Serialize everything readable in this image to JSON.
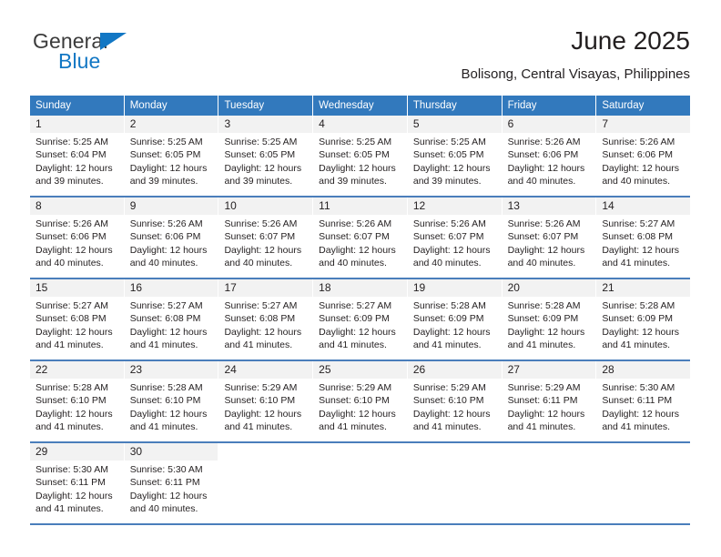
{
  "branding": {
    "logo_primary": "General",
    "logo_secondary": "Blue",
    "logo_accent_color": "#1277c4"
  },
  "header": {
    "title": "June 2025",
    "subtitle": "Bolisong, Central Visayas, Philippines"
  },
  "theme": {
    "header_bg": "#3279bd",
    "row_divider": "#4a7ebb",
    "day_number_bg": "#f2f2f2",
    "text_color": "#231f20"
  },
  "calendar": {
    "weekdays": [
      "Sunday",
      "Monday",
      "Tuesday",
      "Wednesday",
      "Thursday",
      "Friday",
      "Saturday"
    ],
    "weeks": [
      [
        {
          "day": "1",
          "sunrise": "Sunrise: 5:25 AM",
          "sunset": "Sunset: 6:04 PM",
          "daylight": "Daylight: 12 hours and 39 minutes."
        },
        {
          "day": "2",
          "sunrise": "Sunrise: 5:25 AM",
          "sunset": "Sunset: 6:05 PM",
          "daylight": "Daylight: 12 hours and 39 minutes."
        },
        {
          "day": "3",
          "sunrise": "Sunrise: 5:25 AM",
          "sunset": "Sunset: 6:05 PM",
          "daylight": "Daylight: 12 hours and 39 minutes."
        },
        {
          "day": "4",
          "sunrise": "Sunrise: 5:25 AM",
          "sunset": "Sunset: 6:05 PM",
          "daylight": "Daylight: 12 hours and 39 minutes."
        },
        {
          "day": "5",
          "sunrise": "Sunrise: 5:25 AM",
          "sunset": "Sunset: 6:05 PM",
          "daylight": "Daylight: 12 hours and 39 minutes."
        },
        {
          "day": "6",
          "sunrise": "Sunrise: 5:26 AM",
          "sunset": "Sunset: 6:06 PM",
          "daylight": "Daylight: 12 hours and 40 minutes."
        },
        {
          "day": "7",
          "sunrise": "Sunrise: 5:26 AM",
          "sunset": "Sunset: 6:06 PM",
          "daylight": "Daylight: 12 hours and 40 minutes."
        }
      ],
      [
        {
          "day": "8",
          "sunrise": "Sunrise: 5:26 AM",
          "sunset": "Sunset: 6:06 PM",
          "daylight": "Daylight: 12 hours and 40 minutes."
        },
        {
          "day": "9",
          "sunrise": "Sunrise: 5:26 AM",
          "sunset": "Sunset: 6:06 PM",
          "daylight": "Daylight: 12 hours and 40 minutes."
        },
        {
          "day": "10",
          "sunrise": "Sunrise: 5:26 AM",
          "sunset": "Sunset: 6:07 PM",
          "daylight": "Daylight: 12 hours and 40 minutes."
        },
        {
          "day": "11",
          "sunrise": "Sunrise: 5:26 AM",
          "sunset": "Sunset: 6:07 PM",
          "daylight": "Daylight: 12 hours and 40 minutes."
        },
        {
          "day": "12",
          "sunrise": "Sunrise: 5:26 AM",
          "sunset": "Sunset: 6:07 PM",
          "daylight": "Daylight: 12 hours and 40 minutes."
        },
        {
          "day": "13",
          "sunrise": "Sunrise: 5:26 AM",
          "sunset": "Sunset: 6:07 PM",
          "daylight": "Daylight: 12 hours and 40 minutes."
        },
        {
          "day": "14",
          "sunrise": "Sunrise: 5:27 AM",
          "sunset": "Sunset: 6:08 PM",
          "daylight": "Daylight: 12 hours and 41 minutes."
        }
      ],
      [
        {
          "day": "15",
          "sunrise": "Sunrise: 5:27 AM",
          "sunset": "Sunset: 6:08 PM",
          "daylight": "Daylight: 12 hours and 41 minutes."
        },
        {
          "day": "16",
          "sunrise": "Sunrise: 5:27 AM",
          "sunset": "Sunset: 6:08 PM",
          "daylight": "Daylight: 12 hours and 41 minutes."
        },
        {
          "day": "17",
          "sunrise": "Sunrise: 5:27 AM",
          "sunset": "Sunset: 6:08 PM",
          "daylight": "Daylight: 12 hours and 41 minutes."
        },
        {
          "day": "18",
          "sunrise": "Sunrise: 5:27 AM",
          "sunset": "Sunset: 6:09 PM",
          "daylight": "Daylight: 12 hours and 41 minutes."
        },
        {
          "day": "19",
          "sunrise": "Sunrise: 5:28 AM",
          "sunset": "Sunset: 6:09 PM",
          "daylight": "Daylight: 12 hours and 41 minutes."
        },
        {
          "day": "20",
          "sunrise": "Sunrise: 5:28 AM",
          "sunset": "Sunset: 6:09 PM",
          "daylight": "Daylight: 12 hours and 41 minutes."
        },
        {
          "day": "21",
          "sunrise": "Sunrise: 5:28 AM",
          "sunset": "Sunset: 6:09 PM",
          "daylight": "Daylight: 12 hours and 41 minutes."
        }
      ],
      [
        {
          "day": "22",
          "sunrise": "Sunrise: 5:28 AM",
          "sunset": "Sunset: 6:10 PM",
          "daylight": "Daylight: 12 hours and 41 minutes."
        },
        {
          "day": "23",
          "sunrise": "Sunrise: 5:28 AM",
          "sunset": "Sunset: 6:10 PM",
          "daylight": "Daylight: 12 hours and 41 minutes."
        },
        {
          "day": "24",
          "sunrise": "Sunrise: 5:29 AM",
          "sunset": "Sunset: 6:10 PM",
          "daylight": "Daylight: 12 hours and 41 minutes."
        },
        {
          "day": "25",
          "sunrise": "Sunrise: 5:29 AM",
          "sunset": "Sunset: 6:10 PM",
          "daylight": "Daylight: 12 hours and 41 minutes."
        },
        {
          "day": "26",
          "sunrise": "Sunrise: 5:29 AM",
          "sunset": "Sunset: 6:10 PM",
          "daylight": "Daylight: 12 hours and 41 minutes."
        },
        {
          "day": "27",
          "sunrise": "Sunrise: 5:29 AM",
          "sunset": "Sunset: 6:11 PM",
          "daylight": "Daylight: 12 hours and 41 minutes."
        },
        {
          "day": "28",
          "sunrise": "Sunrise: 5:30 AM",
          "sunset": "Sunset: 6:11 PM",
          "daylight": "Daylight: 12 hours and 41 minutes."
        }
      ],
      [
        {
          "day": "29",
          "sunrise": "Sunrise: 5:30 AM",
          "sunset": "Sunset: 6:11 PM",
          "daylight": "Daylight: 12 hours and 41 minutes."
        },
        {
          "day": "30",
          "sunrise": "Sunrise: 5:30 AM",
          "sunset": "Sunset: 6:11 PM",
          "daylight": "Daylight: 12 hours and 40 minutes."
        },
        {
          "day": "",
          "sunrise": "",
          "sunset": "",
          "daylight": ""
        },
        {
          "day": "",
          "sunrise": "",
          "sunset": "",
          "daylight": ""
        },
        {
          "day": "",
          "sunrise": "",
          "sunset": "",
          "daylight": ""
        },
        {
          "day": "",
          "sunrise": "",
          "sunset": "",
          "daylight": ""
        },
        {
          "day": "",
          "sunrise": "",
          "sunset": "",
          "daylight": ""
        }
      ]
    ]
  }
}
